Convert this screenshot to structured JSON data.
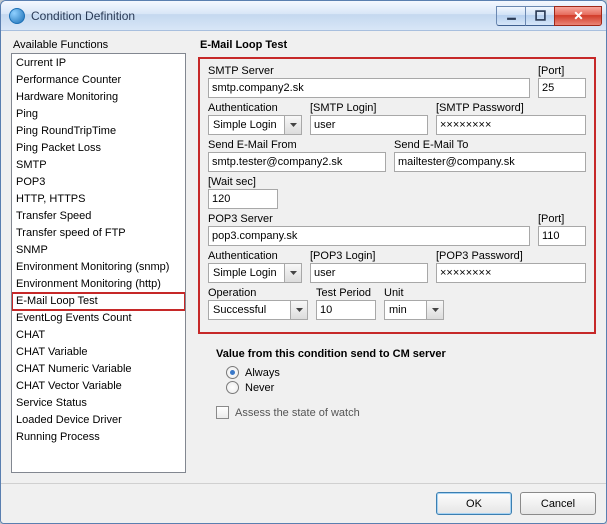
{
  "window": {
    "title": "Condition Definition"
  },
  "left": {
    "label": "Available Functions",
    "items": [
      "Current IP",
      "Performance Counter",
      "Hardware Monitoring",
      "Ping",
      "Ping RoundTripTime",
      "Ping Packet Loss",
      "SMTP",
      "POP3",
      "HTTP, HTTPS",
      "Transfer Speed",
      "Transfer speed of FTP",
      "SNMP",
      "Environment Monitoring (snmp)",
      "Environment Monitoring (http)",
      "E-Mail Loop Test",
      "EventLog Events Count",
      "CHAT",
      "CHAT Variable",
      "CHAT Numeric Variable",
      "CHAT Vector Variable",
      "Service Status",
      "Loaded Device Driver",
      "Running Process"
    ],
    "selected_index": 14
  },
  "right": {
    "title": "E-Mail Loop Test",
    "smtp_server_label": "SMTP Server",
    "smtp_server": "smtp.company2.sk",
    "smtp_port_label": "[Port]",
    "smtp_port": "25",
    "auth_label": "Authentication",
    "auth_value": "Simple Login",
    "smtp_login_label": "[SMTP Login]",
    "smtp_login": "user",
    "smtp_pass_label": "[SMTP Password]",
    "smtp_pass": "××××××××",
    "from_label": "Send E-Mail From",
    "from": "smtp.tester@company2.sk",
    "to_label": "Send E-Mail To",
    "to": "mailtester@company.sk",
    "wait_label": "[Wait sec]",
    "wait": "120",
    "pop3_server_label": "POP3 Server",
    "pop3_server": "pop3.company.sk",
    "pop3_port_label": "[Port]",
    "pop3_port": "110",
    "pop3_auth_label": "Authentication",
    "pop3_auth_value": "Simple Login",
    "pop3_login_label": "[POP3 Login]",
    "pop3_login": "user",
    "pop3_pass_label": "[POP3 Password]",
    "pop3_pass": "××××××××",
    "operation_label": "Operation",
    "operation_value": "Successful",
    "testperiod_label": "Test Period",
    "testperiod": "10",
    "unit_label": "Unit",
    "unit_value": "min"
  },
  "send": {
    "title": "Value from this condition send to CM server",
    "always": "Always",
    "never": "Never",
    "assess": "Assess the state of watch"
  },
  "footer": {
    "ok": "OK",
    "cancel": "Cancel"
  }
}
